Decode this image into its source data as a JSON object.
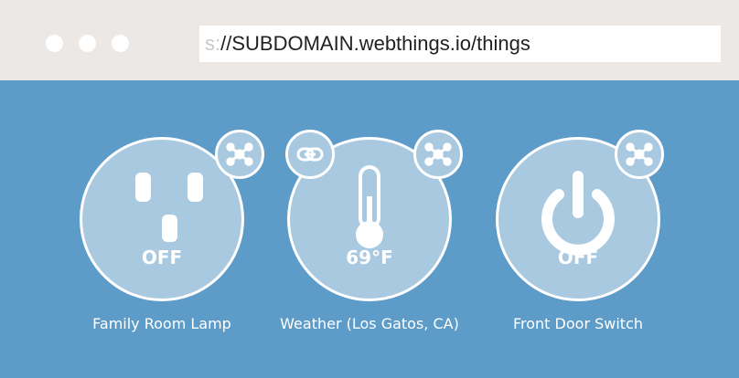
{
  "browser": {
    "url_scheme": "s:",
    "url_rest": "//SUBDOMAIN.webthings.io/things"
  },
  "things": [
    {
      "name": "Family Room Lamp",
      "status": "OFF",
      "icon": "outlet-icon",
      "badges": [
        "network-icon"
      ]
    },
    {
      "name": "Weather (Los Gatos, CA)",
      "status": "69°F",
      "icon": "thermometer-icon",
      "badges": [
        "link-icon",
        "network-icon"
      ]
    },
    {
      "name": "Front Door Switch",
      "status": "OFF",
      "icon": "power-icon",
      "badges": [
        "network-icon"
      ]
    }
  ],
  "colors": {
    "background": "#5d9bc8",
    "tile": "#a9c9e1",
    "chrome": "#ebe8e6",
    "foreground": "#ffffff"
  }
}
